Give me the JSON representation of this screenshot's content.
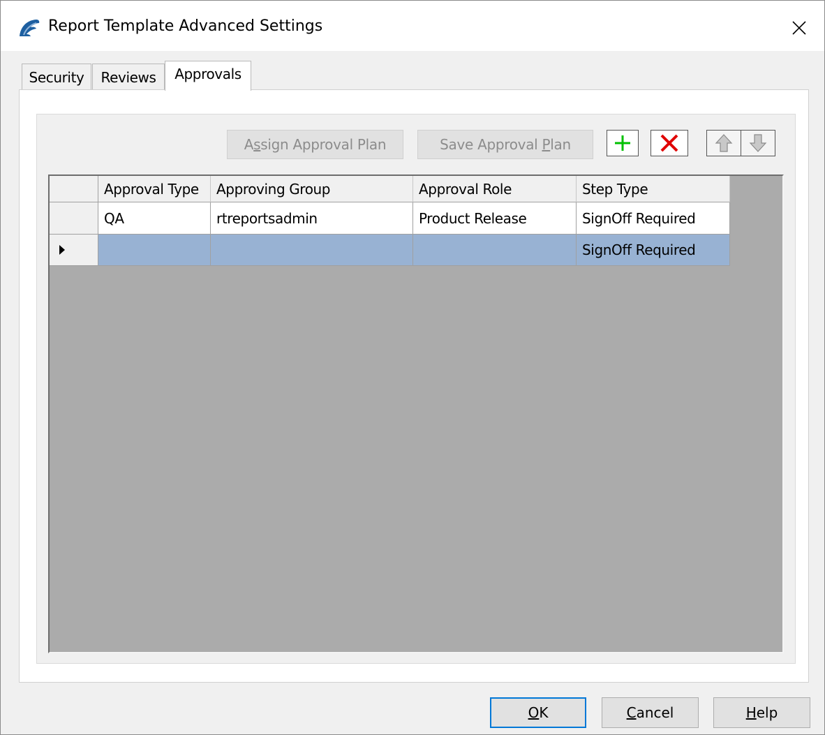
{
  "window": {
    "title": "Report Template Advanced Settings",
    "icon": "app-logo-icon",
    "close_icon": "close-icon"
  },
  "tabs": [
    {
      "label": "Security",
      "active": false
    },
    {
      "label": "Reviews",
      "active": false
    },
    {
      "label": "Approvals",
      "active": true
    }
  ],
  "toolbar": {
    "assign_label": {
      "pre": "A",
      "key": "s",
      "post": "sign Approval Plan"
    },
    "save_label": {
      "pre": "Save Approval ",
      "key": "P",
      "post": "lan"
    },
    "add_icon": "plus-icon",
    "delete_icon": "x-icon",
    "up_icon": "arrow-up-icon",
    "down_icon": "arrow-down-icon",
    "colors": {
      "add": "#00c000",
      "delete": "#e00000",
      "disabled_text": "#8c8c8c"
    }
  },
  "grid": {
    "columns": [
      "Approval Type",
      "Approving Group",
      "Approval Role",
      "Step Type"
    ],
    "rows": [
      {
        "approval_type": "QA",
        "approving_group": "rtreportsadmin",
        "approval_role": "Product Release",
        "step_type": "SignOff Required",
        "selected": false
      },
      {
        "approval_type": "",
        "approving_group": "",
        "approval_role": "",
        "step_type": "SignOff Required",
        "selected": true
      }
    ],
    "colors": {
      "background": "#ababab",
      "selection": "#98b2d3"
    }
  },
  "buttons": {
    "ok": {
      "key": "O",
      "post": "K"
    },
    "cancel": {
      "key": "C",
      "post": "ancel"
    },
    "help": {
      "key": "H",
      "post": "elp"
    }
  }
}
